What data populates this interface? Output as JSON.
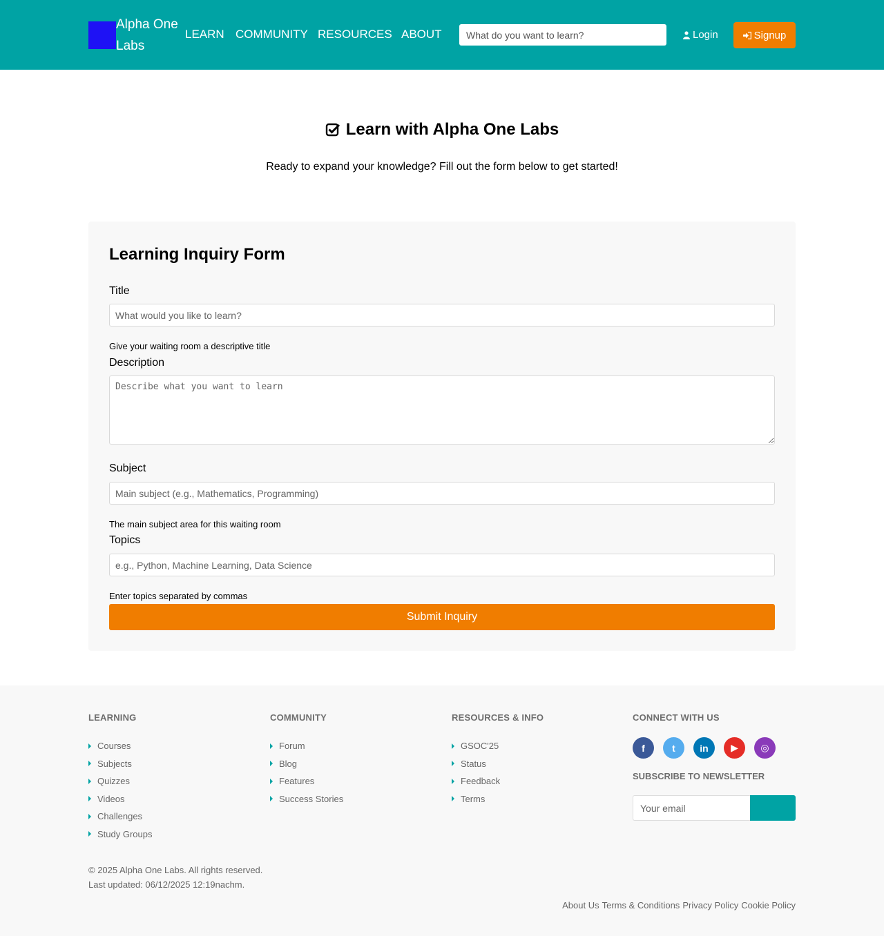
{
  "header": {
    "brand": "Alpha One Labs",
    "nav": [
      "LEARN",
      "COMMUNITY",
      "RESOURCES",
      "ABOUT"
    ],
    "search_placeholder": "What do you want to learn?",
    "login_label": "Login",
    "signup_label": "Signup",
    "colors": {
      "header_bg": "#00a3a4",
      "logo": "#1e12f5",
      "accent": "#f07d00"
    }
  },
  "hero": {
    "icon": "check-square-icon",
    "title": "Learn with Alpha One Labs",
    "subtitle": "Ready to expand your knowledge? Fill out the form below to get started!"
  },
  "form": {
    "title": "Learning Inquiry Form",
    "title_label": "Title",
    "title_placeholder": "What would you like to learn?",
    "title_help": "Give your waiting room a descriptive title",
    "description_label": "Description",
    "description_placeholder": "Describe what you want to learn",
    "subject_label": "Subject",
    "subject_placeholder": "Main subject (e.g., Mathematics, Programming)",
    "subject_help": "The main subject area for this waiting room",
    "topics_label": "Topics",
    "topics_placeholder": "e.g., Python, Machine Learning, Data Science",
    "topics_help": "Enter topics separated by commas",
    "submit_label": "Submit Inquiry"
  },
  "footer": {
    "learning": {
      "title": "LEARNING",
      "items": [
        "Courses",
        "Subjects",
        "Quizzes",
        "Videos",
        "Challenges",
        "Study Groups"
      ]
    },
    "community": {
      "title": "COMMUNITY",
      "items": [
        "Forum",
        "Blog",
        "Features",
        "Success Stories"
      ]
    },
    "resources": {
      "title": "RESOURCES & INFO",
      "items": [
        "GSOC'25",
        "Status",
        "Feedback",
        "Terms"
      ]
    },
    "connect": {
      "title": "CONNECT WITH US",
      "socials": [
        {
          "icon": "facebook-icon",
          "glyph": "f",
          "color": "#3b5998"
        },
        {
          "icon": "twitter-icon",
          "glyph": "t",
          "color": "#55acee"
        },
        {
          "icon": "linkedin-icon",
          "glyph": "in",
          "color": "#0077b5"
        },
        {
          "icon": "youtube-icon",
          "glyph": "▶",
          "color": "#e52d27"
        },
        {
          "icon": "instagram-icon",
          "glyph": "◎",
          "color": "#8a3ab9"
        }
      ]
    },
    "newsletter": {
      "title": "SUBSCRIBE TO NEWSLETTER",
      "email_placeholder": "Your email"
    },
    "copyright": "© 2025 Alpha One Labs. All rights reserved.",
    "last_updated": "Last updated: 06/12/2025 12:19nachm.",
    "bottom_links": [
      "About Us",
      "Terms & Conditions",
      "Privacy Policy",
      "Cookie Policy"
    ]
  }
}
